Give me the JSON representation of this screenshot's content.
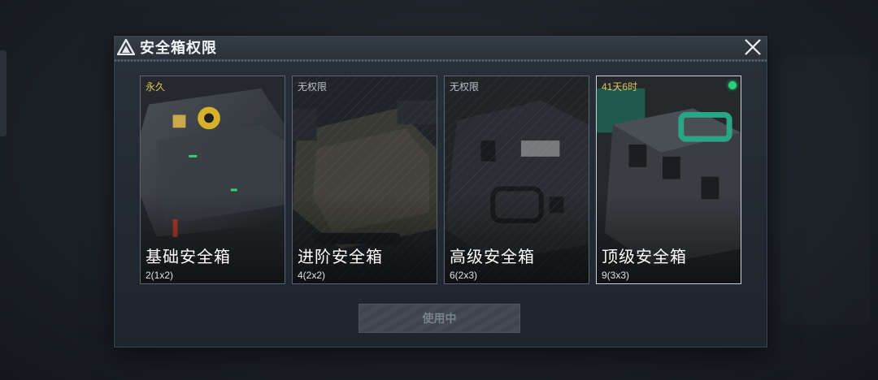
{
  "dialog": {
    "title": "安全箱权限",
    "close_icon": "close-icon",
    "title_icon": "warning-triangle-icon"
  },
  "cards": [
    {
      "tag": "永久",
      "name": "基础安全箱",
      "size": "2(1x2)"
    },
    {
      "tag": "无权限",
      "name": "进阶安全箱",
      "size": "4(2x2)"
    },
    {
      "tag": "无权限",
      "name": "高级安全箱",
      "size": "6(2x3)"
    },
    {
      "tag": "41天6时",
      "name": "顶级安全箱",
      "size": "9(3x3)"
    }
  ],
  "action": {
    "label": "使用中"
  },
  "colors": {
    "tag_gold": "#e4c35a",
    "status_green": "#27d17a",
    "accent_teal": "#2aa687"
  }
}
